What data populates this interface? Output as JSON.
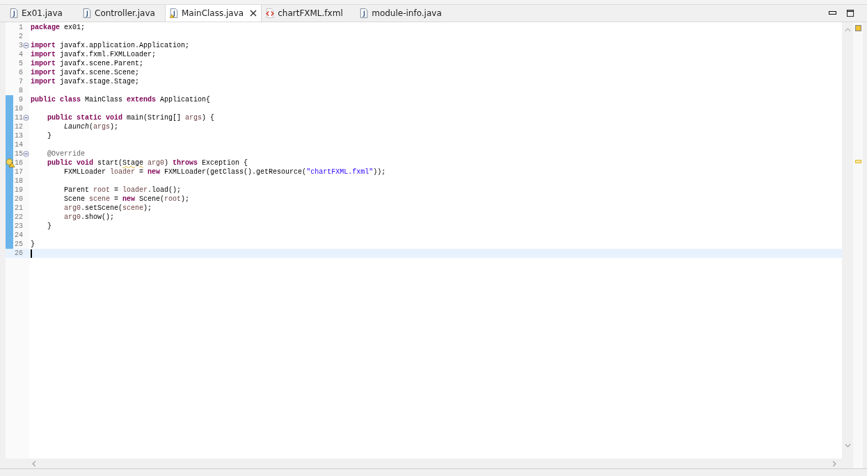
{
  "tabs": [
    {
      "label": "Ex01.java",
      "kind": "java",
      "selected": false,
      "warning": false
    },
    {
      "label": "Controller.java",
      "kind": "java",
      "selected": false,
      "warning": false
    },
    {
      "label": "MainClass.java",
      "kind": "java",
      "selected": true,
      "warning": true
    },
    {
      "label": "chartFXML.fxml",
      "kind": "fxml",
      "selected": false,
      "warning": false
    },
    {
      "label": "module-info.java",
      "kind": "java",
      "selected": false,
      "warning": false
    }
  ],
  "lines": [
    {
      "number": "1",
      "changed": false,
      "foldable": false,
      "warning": false,
      "current": false,
      "tokens": [
        {
          "kind": "keyword",
          "text": "package"
        },
        {
          "kind": "plain",
          "text": " ex01;"
        }
      ]
    },
    {
      "number": "2",
      "changed": false,
      "foldable": false,
      "warning": false,
      "current": false
    },
    {
      "number": "3",
      "changed": false,
      "foldable": true,
      "warning": false,
      "current": false,
      "tokens": [
        {
          "kind": "keyword",
          "text": "import"
        },
        {
          "kind": "plain",
          "text": " javafx.application.Application;"
        }
      ]
    },
    {
      "number": "4",
      "changed": false,
      "foldable": false,
      "warning": false,
      "current": false,
      "tokens": [
        {
          "kind": "keyword",
          "text": "import"
        },
        {
          "kind": "plain",
          "text": " javafx.fxml.FXMLLoader;"
        }
      ]
    },
    {
      "number": "5",
      "changed": false,
      "foldable": false,
      "warning": false,
      "current": false,
      "tokens": [
        {
          "kind": "keyword",
          "text": "import"
        },
        {
          "kind": "plain",
          "text": " javafx.scene.Parent;"
        }
      ]
    },
    {
      "number": "6",
      "changed": false,
      "foldable": false,
      "warning": false,
      "current": false,
      "tokens": [
        {
          "kind": "keyword",
          "text": "import"
        },
        {
          "kind": "plain",
          "text": " javafx.scene.Scene;"
        }
      ]
    },
    {
      "number": "7",
      "changed": false,
      "foldable": false,
      "warning": false,
      "current": false,
      "tokens": [
        {
          "kind": "keyword",
          "text": "import"
        },
        {
          "kind": "plain",
          "text": " javafx.stage.Stage;"
        }
      ]
    },
    {
      "number": "8",
      "changed": false,
      "foldable": false,
      "warning": false,
      "current": false
    },
    {
      "number": "9",
      "changed": true,
      "foldable": false,
      "warning": false,
      "current": false,
      "tokens": [
        {
          "kind": "keyword",
          "text": "public class"
        },
        {
          "kind": "plain",
          "text": " MainClass "
        },
        {
          "kind": "keyword",
          "text": "extends"
        },
        {
          "kind": "plain",
          "text": " Application{"
        }
      ]
    },
    {
      "number": "10",
      "changed": true,
      "foldable": false,
      "warning": false,
      "current": false
    },
    {
      "number": "11",
      "changed": true,
      "foldable": true,
      "warning": false,
      "current": false,
      "tokens": [
        {
          "kind": "keyword",
          "text": "    public static void"
        },
        {
          "kind": "plain",
          "text": " main(String[] "
        },
        {
          "kind": "variable",
          "text": "args"
        },
        {
          "kind": "plain",
          "text": ") {"
        }
      ]
    },
    {
      "number": "12",
      "changed": true,
      "foldable": false,
      "warning": false,
      "current": false,
      "tokens": [
        {
          "kind": "italic",
          "text": "        Launch"
        },
        {
          "kind": "plain",
          "text": "("
        },
        {
          "kind": "variable",
          "text": "args"
        },
        {
          "kind": "plain",
          "text": ");"
        }
      ]
    },
    {
      "number": "13",
      "changed": true,
      "foldable": false,
      "warning": false,
      "current": false,
      "tokens": [
        {
          "kind": "plain",
          "text": "    }"
        }
      ]
    },
    {
      "number": "14",
      "changed": true,
      "foldable": false,
      "warning": false,
      "current": false
    },
    {
      "number": "15",
      "changed": true,
      "foldable": true,
      "warning": false,
      "current": false,
      "tokens": [
        {
          "kind": "annotation",
          "text": "    @Override"
        }
      ]
    },
    {
      "number": "16",
      "changed": true,
      "foldable": false,
      "warning": true,
      "current": false,
      "tokens": [
        {
          "kind": "keyword",
          "text": "    public void"
        },
        {
          "kind": "plain",
          "text": " start("
        },
        {
          "kind": "squiggle",
          "text": "Stage"
        },
        {
          "kind": "variable",
          "text": " arg0"
        },
        {
          "kind": "plain",
          "text": ") "
        },
        {
          "kind": "keyword",
          "text": "throws"
        },
        {
          "kind": "plain",
          "text": " Exception {"
        }
      ]
    },
    {
      "number": "17",
      "changed": true,
      "foldable": false,
      "warning": false,
      "current": false,
      "tokens": [
        {
          "kind": "plain",
          "text": "        FXMLLoader "
        },
        {
          "kind": "variable",
          "text": "loader"
        },
        {
          "kind": "plain",
          "text": " = "
        },
        {
          "kind": "keyword",
          "text": "new"
        },
        {
          "kind": "plain",
          "text": " FXMLLoader(getClass().getResource("
        },
        {
          "kind": "string",
          "text": "\"chartFXML.fxml\""
        },
        {
          "kind": "plain",
          "text": "));"
        }
      ]
    },
    {
      "number": "18",
      "changed": true,
      "foldable": false,
      "warning": false,
      "current": false
    },
    {
      "number": "19",
      "changed": true,
      "foldable": false,
      "warning": false,
      "current": false,
      "tokens": [
        {
          "kind": "plain",
          "text": "        Parent "
        },
        {
          "kind": "variable",
          "text": "root"
        },
        {
          "kind": "plain",
          "text": " = "
        },
        {
          "kind": "variable",
          "text": "loader"
        },
        {
          "kind": "plain",
          "text": ".load();"
        }
      ]
    },
    {
      "number": "20",
      "changed": true,
      "foldable": false,
      "warning": false,
      "current": false,
      "tokens": [
        {
          "kind": "plain",
          "text": "        Scene "
        },
        {
          "kind": "variable",
          "text": "scene"
        },
        {
          "kind": "plain",
          "text": " = "
        },
        {
          "kind": "keyword",
          "text": "new"
        },
        {
          "kind": "plain",
          "text": " Scene("
        },
        {
          "kind": "variable",
          "text": "root"
        },
        {
          "kind": "plain",
          "text": ");"
        }
      ]
    },
    {
      "number": "21",
      "changed": true,
      "foldable": false,
      "warning": false,
      "current": false,
      "tokens": [
        {
          "kind": "variable",
          "text": "        arg0"
        },
        {
          "kind": "plain",
          "text": ".setScene("
        },
        {
          "kind": "variable",
          "text": "scene"
        },
        {
          "kind": "plain",
          "text": ");"
        }
      ]
    },
    {
      "number": "22",
      "changed": true,
      "foldable": false,
      "warning": false,
      "current": false,
      "tokens": [
        {
          "kind": "variable",
          "text": "        arg0"
        },
        {
          "kind": "plain",
          "text": ".show();"
        }
      ]
    },
    {
      "number": "23",
      "changed": true,
      "foldable": false,
      "warning": false,
      "current": false,
      "tokens": [
        {
          "kind": "plain",
          "text": "    }"
        }
      ]
    },
    {
      "number": "24",
      "changed": true,
      "foldable": false,
      "warning": false,
      "current": false
    },
    {
      "number": "25",
      "changed": true,
      "foldable": false,
      "warning": false,
      "current": false,
      "tokens": [
        {
          "kind": "plain",
          "text": "}"
        }
      ]
    },
    {
      "number": "26",
      "changed": false,
      "foldable": false,
      "warning": false,
      "current": true
    }
  ]
}
